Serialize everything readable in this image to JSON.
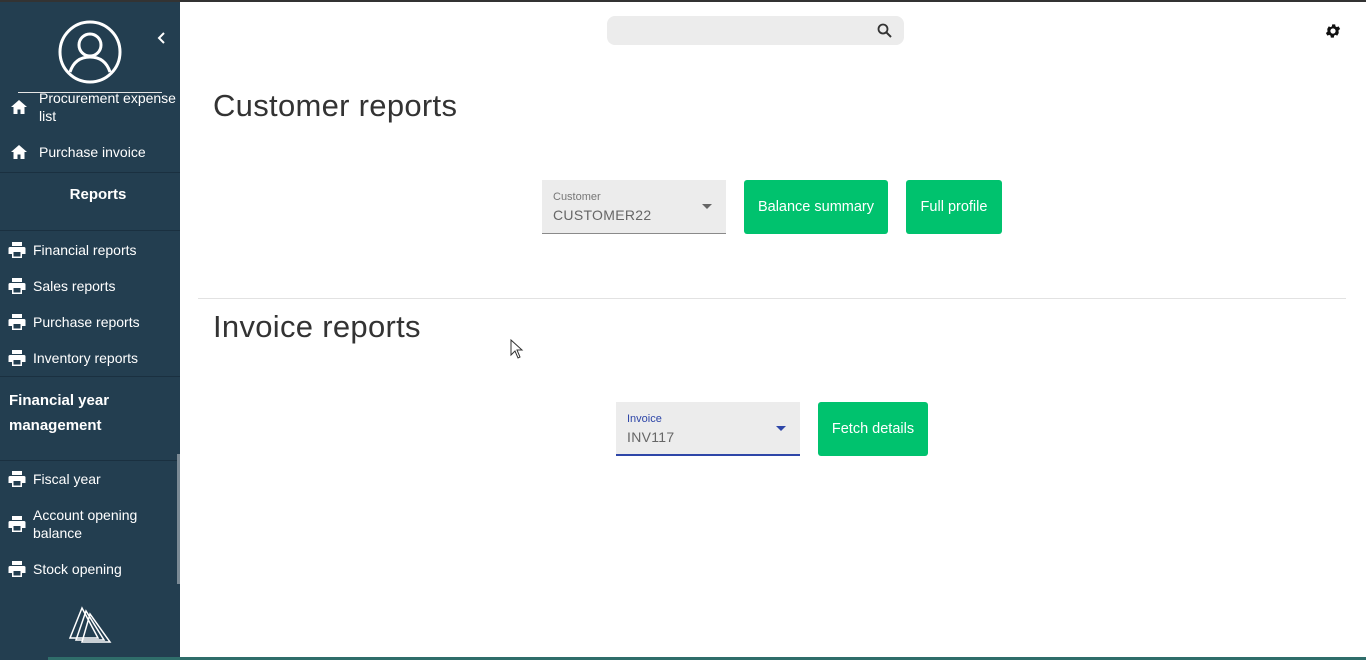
{
  "sidebar": {
    "items_top": [
      {
        "label": "Procurement expense list"
      },
      {
        "label": "Purchase invoice"
      }
    ],
    "reports_heading": "Reports",
    "report_items": [
      {
        "label": "Financial reports"
      },
      {
        "label": "Sales reports"
      },
      {
        "label": "Purchase reports"
      },
      {
        "label": "Inventory reports"
      }
    ],
    "fy_heading": "Financial year management",
    "fy_items": [
      {
        "label": "Fiscal year"
      },
      {
        "label": "Account opening balance"
      },
      {
        "label": "Stock opening"
      }
    ]
  },
  "search": {
    "placeholder": "",
    "value": ""
  },
  "customer_section": {
    "title": "Customer reports",
    "select_label": "Customer",
    "select_value": "CUSTOMER22",
    "balance_button": "Balance summary",
    "profile_button": "Full profile"
  },
  "invoice_section": {
    "title": "Invoice reports",
    "select_label": "Invoice",
    "select_value": "INV117",
    "fetch_button": "Fetch details"
  },
  "colors": {
    "sidebar_bg": "#233e50",
    "accent_green": "#00c26e",
    "focus_blue": "#2e46a8"
  },
  "icons": {
    "avatar": "user-circle-icon",
    "collapse": "chevron-left-icon",
    "home": "home-icon",
    "print": "print-icon",
    "search": "search-icon",
    "settings": "gear-icon",
    "logo": "triangle-logo-icon"
  }
}
